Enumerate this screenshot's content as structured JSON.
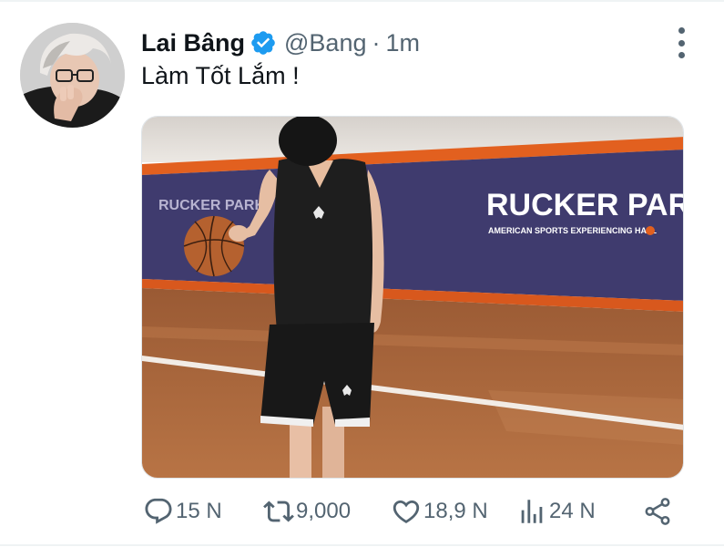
{
  "tweet": {
    "author": {
      "display_name": "Lai Bâng",
      "handle": "@Bang",
      "verified": true
    },
    "separator": "·",
    "time": "1m",
    "text": "Làm Tốt Lắm !",
    "media": {
      "sign_text": "RUCKER PARK",
      "sign_subtext": "AMERICAN SPORTS EXPERIENCING HALL",
      "sign_text_left": "RUCKER PARK"
    }
  },
  "actions": {
    "reply": {
      "icon": "reply-icon",
      "count": "15 N"
    },
    "retweet": {
      "icon": "retweet-icon",
      "count": "9,000"
    },
    "like": {
      "icon": "heart-icon",
      "count": "18,9 N"
    },
    "views": {
      "icon": "views-icon",
      "count": "24 N"
    },
    "share": {
      "icon": "share-icon"
    }
  },
  "colors": {
    "verified": "#1d9bf0",
    "text_primary": "#0f1419",
    "text_secondary": "#536471",
    "court_wall": "#3f3b6e",
    "court_stripe": "#e2601f",
    "court_floor": "#b06a3b"
  }
}
